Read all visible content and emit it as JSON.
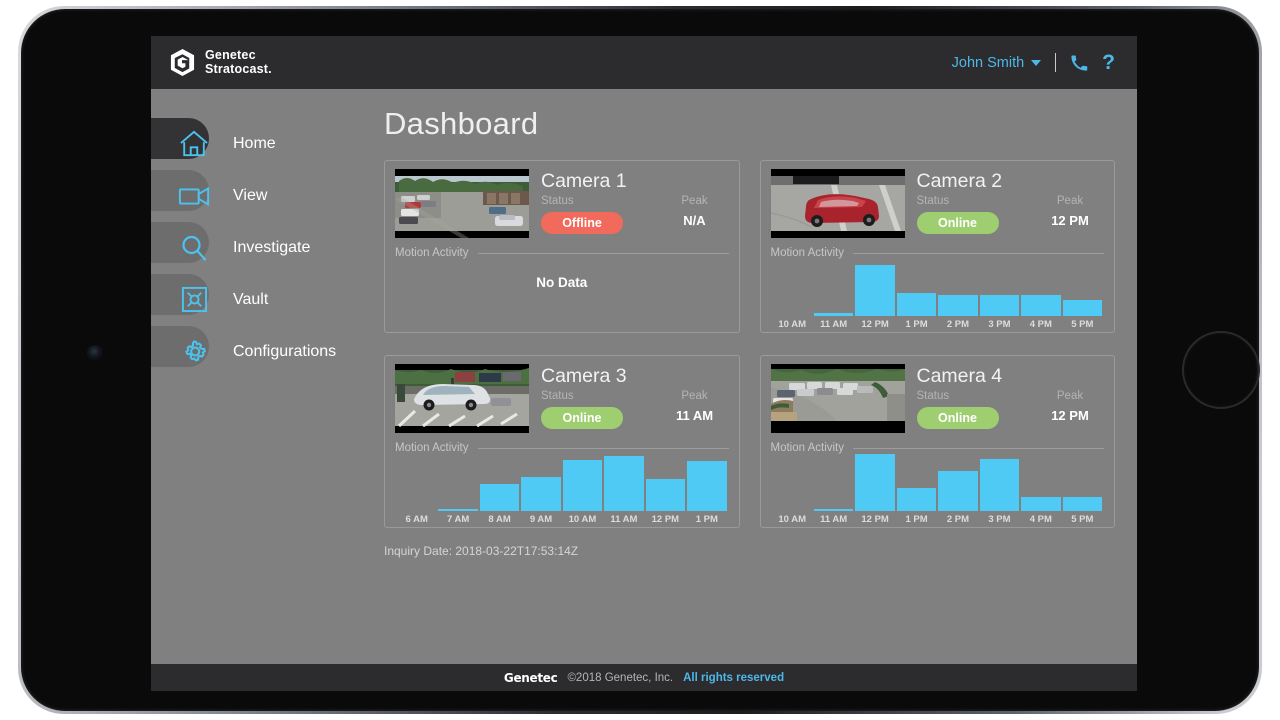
{
  "brand": {
    "line1": "Genetec",
    "line2": "Stratocast.",
    "logo_icon": "genetec-hex-icon"
  },
  "topbar": {
    "user_name": "John Smith",
    "caret_icon": "chevron-down-icon",
    "phone_icon": "phone-icon",
    "phone_glyph": "✆",
    "help_icon": "help-question-icon",
    "help_glyph": "?"
  },
  "sidebar": {
    "items": [
      {
        "label": "Home",
        "icon": "home-icon",
        "active": true
      },
      {
        "label": "View",
        "icon": "video-camera-icon",
        "active": false
      },
      {
        "label": "Investigate",
        "icon": "search-icon",
        "active": false
      },
      {
        "label": "Vault",
        "icon": "vault-box-icon",
        "active": false
      },
      {
        "label": "Configurations",
        "icon": "gear-icon",
        "active": false
      }
    ]
  },
  "page": {
    "title": "Dashboard",
    "inquiry_date": "Inquiry Date: 2018-03-22T17:53:14Z",
    "status_label": "Status",
    "peak_label": "Peak",
    "motion_label": "Motion Activity",
    "no_data_label": "No Data"
  },
  "colors": {
    "accent_blue": "#4cb8e8",
    "icon_blue": "#4cc3ef",
    "bar_blue": "#4ecaf5",
    "online_green": "#9fce71",
    "offline_red": "#f26a5b",
    "screen_bg": "#808080",
    "chrome_dark": "#2c2c2e"
  },
  "cameras": [
    {
      "name": "Camera 1",
      "status": "Offline",
      "status_kind": "offline",
      "peak": "N/A",
      "thumbnail": "parking-lot-wide-view",
      "has_data": false
    },
    {
      "name": "Camera 2",
      "status": "Online",
      "status_kind": "online",
      "peak": "12 PM",
      "thumbnail": "red-car-close-view",
      "has_data": true
    },
    {
      "name": "Camera 3",
      "status": "Online",
      "status_kind": "online",
      "peak": "11 AM",
      "thumbnail": "white-van-parking-view",
      "has_data": true
    },
    {
      "name": "Camera 4",
      "status": "Online",
      "status_kind": "online",
      "peak": "12 PM",
      "thumbnail": "parking-lot-driveway-view",
      "has_data": true
    }
  ],
  "chart_data": [
    {
      "type": "bar",
      "title": "Camera 1 Motion Activity",
      "categories": [],
      "values": [],
      "xlabel": "",
      "ylabel": "Motion Activity",
      "note": "No Data"
    },
    {
      "type": "bar",
      "title": "Camera 2 Motion Activity",
      "categories": [
        "10 AM",
        "11 AM",
        "12 PM",
        "1 PM",
        "2 PM",
        "3 PM",
        "4 PM",
        "5 PM"
      ],
      "values": [
        0,
        3,
        45,
        20,
        18,
        18,
        18,
        14
      ],
      "ylim": [
        0,
        50
      ],
      "xlabel": "",
      "ylabel": "Motion Activity",
      "peak_category": "12 PM",
      "grid": false,
      "legend": false
    },
    {
      "type": "bar",
      "title": "Camera 3 Motion Activity",
      "categories": [
        "6 AM",
        "7 AM",
        "8 AM",
        "9 AM",
        "10 AM",
        "11 AM",
        "12 PM",
        "1 PM"
      ],
      "values": [
        0,
        2,
        24,
        30,
        45,
        48,
        28,
        44
      ],
      "ylim": [
        0,
        50
      ],
      "xlabel": "",
      "ylabel": "Motion Activity",
      "peak_category": "11 AM",
      "grid": false,
      "legend": false
    },
    {
      "type": "bar",
      "title": "Camera 4 Motion Activity",
      "categories": [
        "10 AM",
        "11 AM",
        "12 PM",
        "1 PM",
        "2 PM",
        "3 PM",
        "4 PM",
        "5 PM"
      ],
      "values": [
        0,
        2,
        50,
        20,
        35,
        46,
        12,
        12
      ],
      "ylim": [
        0,
        50
      ],
      "xlabel": "",
      "ylabel": "Motion Activity",
      "peak_category": "12 PM",
      "grid": false,
      "legend": false
    }
  ],
  "footer": {
    "logo": "Genetec",
    "copyright": "©2018 Genetec, Inc.",
    "rights": "All rights reserved"
  }
}
